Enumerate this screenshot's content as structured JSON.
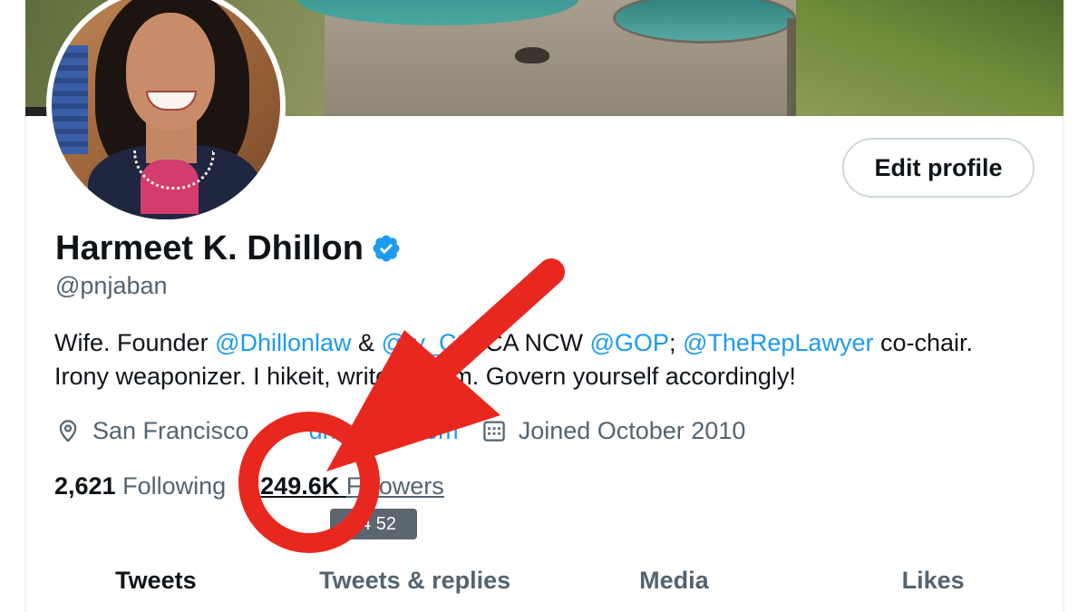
{
  "profile": {
    "display_name": "Harmeet K. Dhillon",
    "handle": "@pnjaban",
    "edit_button_label": "Edit profile"
  },
  "bio": {
    "segments": [
      {
        "text": "Wife. Founder ",
        "link": false
      },
      {
        "text": "@Dhillonlaw",
        "link": true
      },
      {
        "text": " & ",
        "link": false
      },
      {
        "text": "@",
        "link": true
      },
      {
        "text": "ty_Ctr",
        "link": true
      },
      {
        "text": "; CA NCW ",
        "link": false
      },
      {
        "text": "@GOP",
        "link": true
      },
      {
        "text": "; ",
        "link": false
      },
      {
        "text": "@TheRepLawyer",
        "link": true
      },
      {
        "text": " co-chair. Irony weaponizer. I hike",
        "link": false
      },
      {
        "text": "it, write, dream. Govern yourself accordingly!",
        "link": false
      }
    ]
  },
  "meta": {
    "location": "San Francisco",
    "website": "dh  onlaw.com",
    "joined": "Joined October 2010"
  },
  "stats": {
    "following_count": "2,621",
    "following_label": "Following",
    "followers_count": "249.6K",
    "followers_label": "Followers",
    "followers_label_visible": "F  llowers",
    "tooltip_exact": "24  52"
  },
  "tabs": [
    {
      "label": "Tweets",
      "active": true
    },
    {
      "label": "Tweets & replies",
      "active": false
    },
    {
      "label": "Media",
      "active": false
    },
    {
      "label": "Likes",
      "active": false
    }
  ],
  "icons": {
    "verified": "verified-badge-icon",
    "location": "location-pin-icon",
    "website": "link-icon",
    "joined": "calendar-icon"
  },
  "colors": {
    "accent": "#1d9bf0",
    "text_primary": "#0f1419",
    "text_secondary": "#536471",
    "annotation": "#e8281f"
  }
}
